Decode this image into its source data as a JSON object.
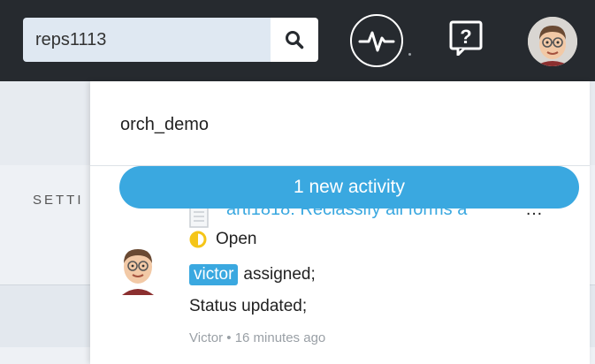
{
  "search": {
    "value": "reps1113",
    "icon": "search-icon"
  },
  "topbar": {
    "activity_icon": "activity-pulse-icon",
    "help_icon": "help-icon",
    "help_glyph": "?"
  },
  "background": {
    "settings_label": "SETTI"
  },
  "panel": {
    "title": "orch_demo",
    "new_activity_label": "1 new activity"
  },
  "activity": {
    "link_text": "arti1818: Reclassify all forms a",
    "ellipsis": "…",
    "status_label": "Open",
    "assignee_tag": "victor",
    "assigned_text": "assigned;",
    "status_updated_text": "Status updated;",
    "author": "Victor",
    "separator": "•",
    "time_ago": "16 minutes ago"
  },
  "colors": {
    "topbar_bg": "#262a2f",
    "accent_blue": "#3aa8e0",
    "status_yellow": "#f5c518"
  }
}
